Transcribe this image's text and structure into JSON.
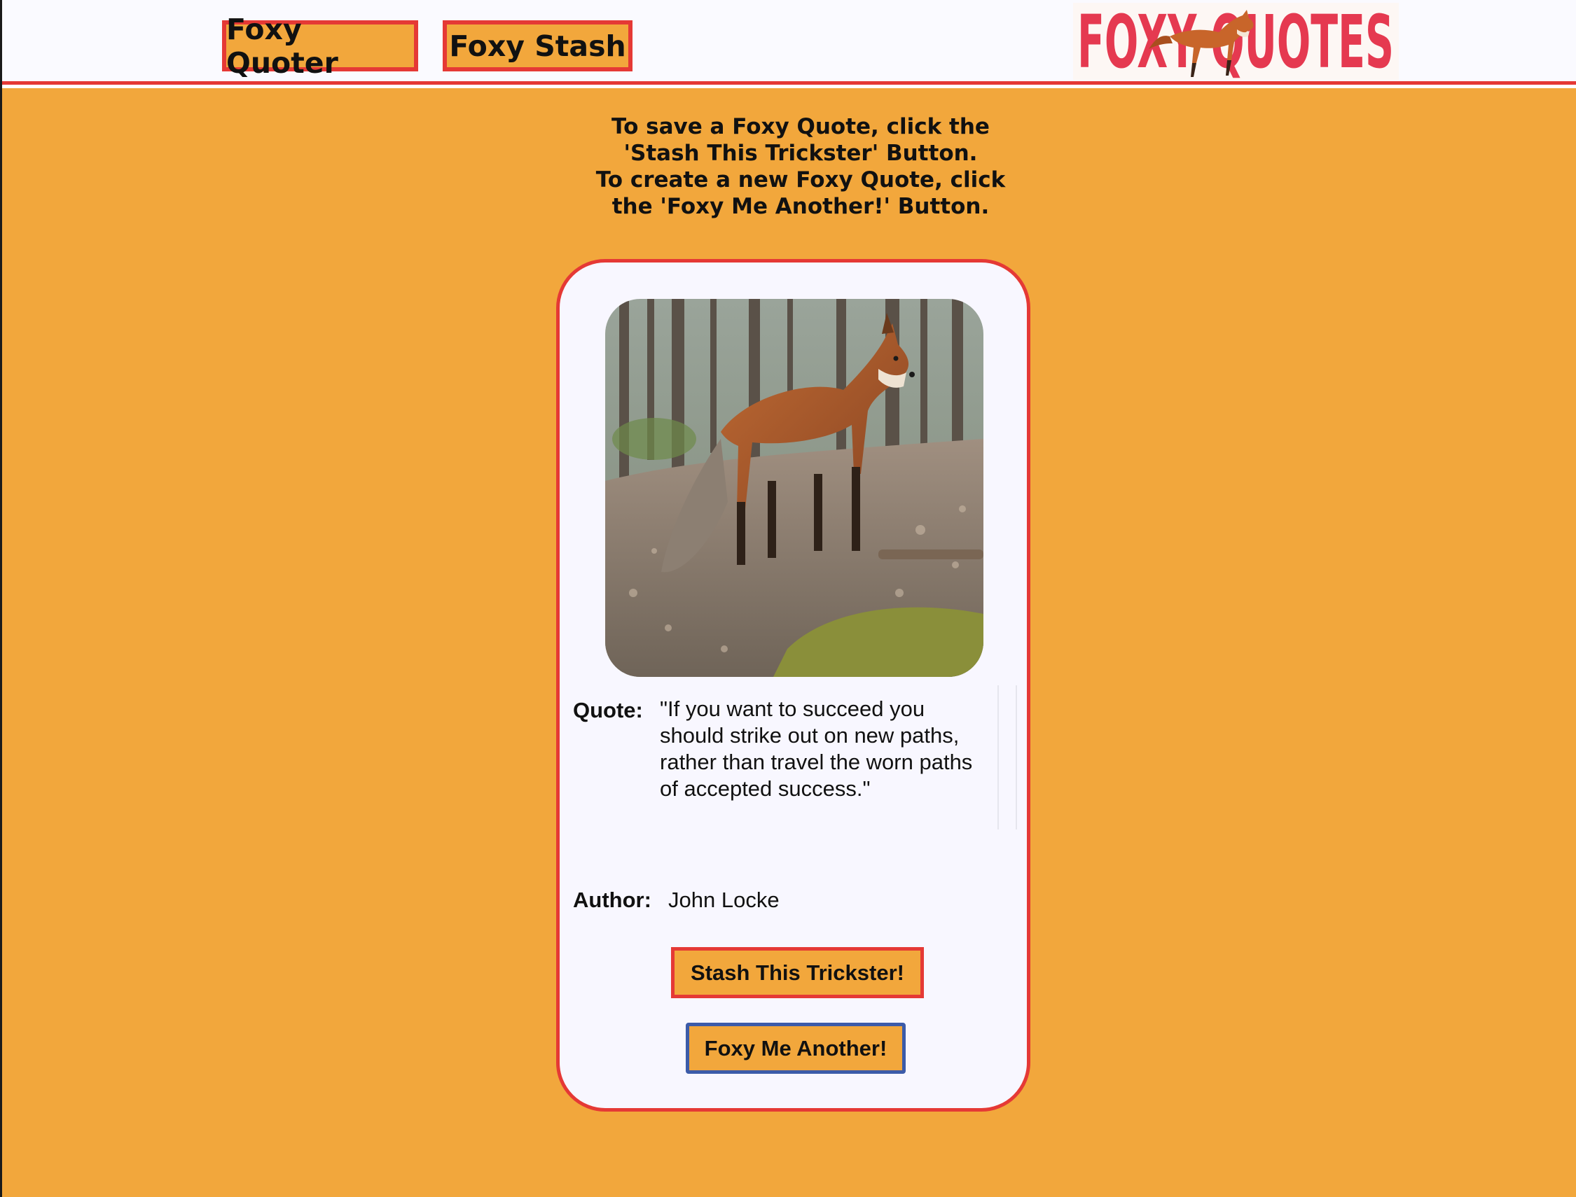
{
  "nav": {
    "quoter_label": "Foxy Quoter",
    "stash_label": "Foxy Stash"
  },
  "logo": {
    "text": "FOXY QUOTES",
    "color": "#e53950"
  },
  "instructions": {
    "lines": [
      "To save a Foxy Quote, click the",
      "'Stash This Trickster' Button.",
      "To create a new Foxy Quote, click",
      "the 'Foxy Me Another!' Button."
    ]
  },
  "card": {
    "image_icon": "fox-photo",
    "quote_label": "Quote:",
    "quote_text": "\"If you want to succeed you should strike out on new paths, rather than travel the worn paths of accepted success.\"",
    "author_label": "Author:",
    "author_name": "John Locke",
    "stash_button": "Stash This Trickster!",
    "another_button": "Foxy Me Another!"
  },
  "colors": {
    "background": "#f2a73c",
    "accent_border": "#e53935",
    "card": "#f8f7ff",
    "focus_border": "#3c5ba9"
  }
}
